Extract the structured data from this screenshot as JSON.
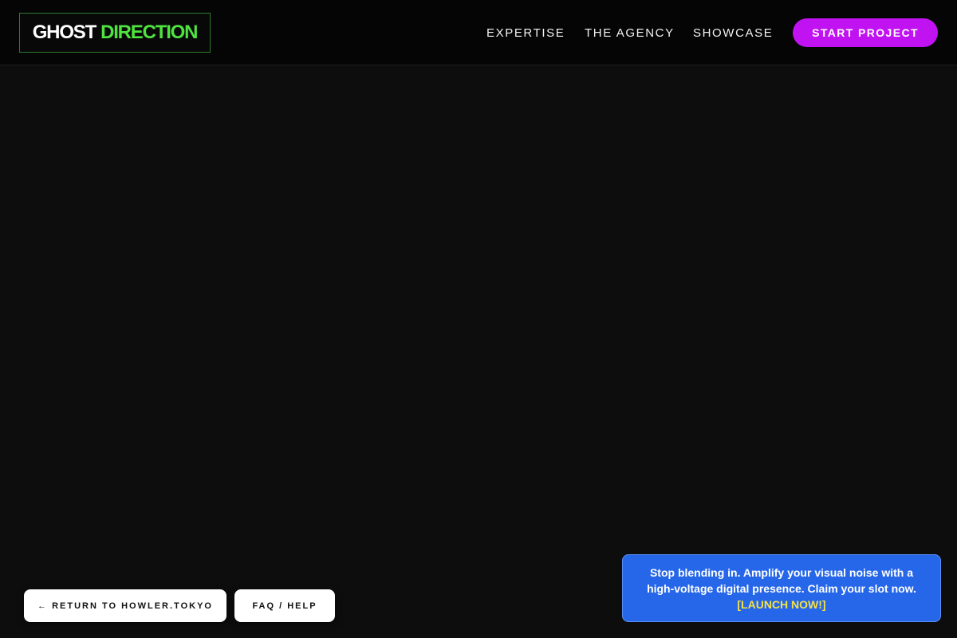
{
  "header": {
    "logo": {
      "word1": "GHOST",
      "word2": "DIRECTION"
    },
    "nav": [
      {
        "label": "EXPERTISE"
      },
      {
        "label": "THE AGENCY"
      },
      {
        "label": "SHOWCASE"
      }
    ],
    "cta_label": "START PROJECT"
  },
  "footer_buttons": {
    "return_label": "← RETURN TO HOWLER.TOKYO",
    "faq_label": "FAQ / HELP"
  },
  "promo": {
    "text": "Stop blending in. Amplify your visual noise with a high-voltage digital presence. Claim your slot now.",
    "link_label": "[LAUNCH NOW!]"
  },
  "colors": {
    "accent_green": "#4ee33f",
    "cta_purple": "#c113f2",
    "promo_blue": "#2667ea",
    "promo_link_yellow": "#f3e14a",
    "background": "#0d0d0d"
  }
}
